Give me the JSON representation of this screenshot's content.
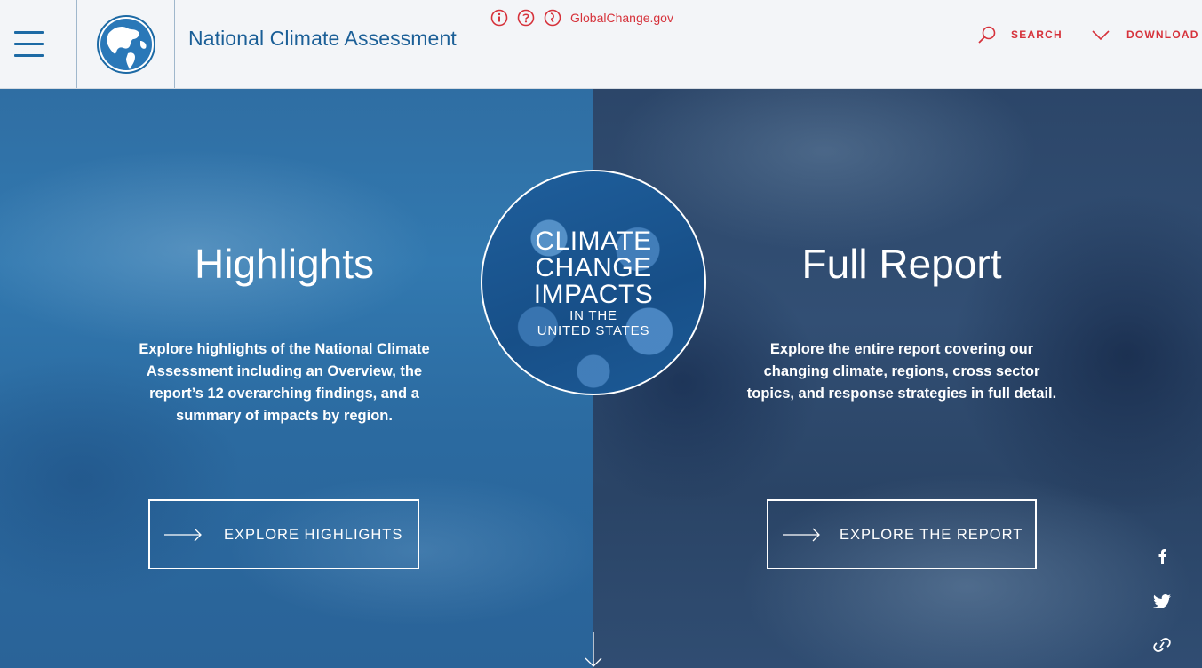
{
  "header": {
    "site_title": "National Climate Assessment",
    "util_icons": [
      "info-icon",
      "help-icon",
      "globalchange-icon"
    ],
    "globalchange_link": "GlobalChange.gov",
    "search_label": "SEARCH",
    "download_label": "DOWNLOAD"
  },
  "hero": {
    "left": {
      "title": "Highlights",
      "description": "Explore highlights of the National Climate Assessment including an Overview, the report’s 12 overarching findings, and a summary of impacts by region.",
      "button_label": "EXPLORE HIGHLIGHTS"
    },
    "badge": {
      "line1": "CLIMATE",
      "line2": "CHANGE",
      "line3": "IMPACTS",
      "line4": "IN THE",
      "line5": "UNITED STATES"
    },
    "right": {
      "title": "Full Report",
      "description": "Explore the entire report covering our changing climate, regions, cross sector topics, and response strategies in full detail.",
      "button_label": "EXPLORE THE REPORT"
    }
  },
  "social": [
    "facebook-icon",
    "twitter-icon",
    "link-icon"
  ],
  "colors": {
    "accent_red": "#d6323b",
    "brand_blue": "#1b5f97",
    "header_bg": "#f3f5f8"
  }
}
